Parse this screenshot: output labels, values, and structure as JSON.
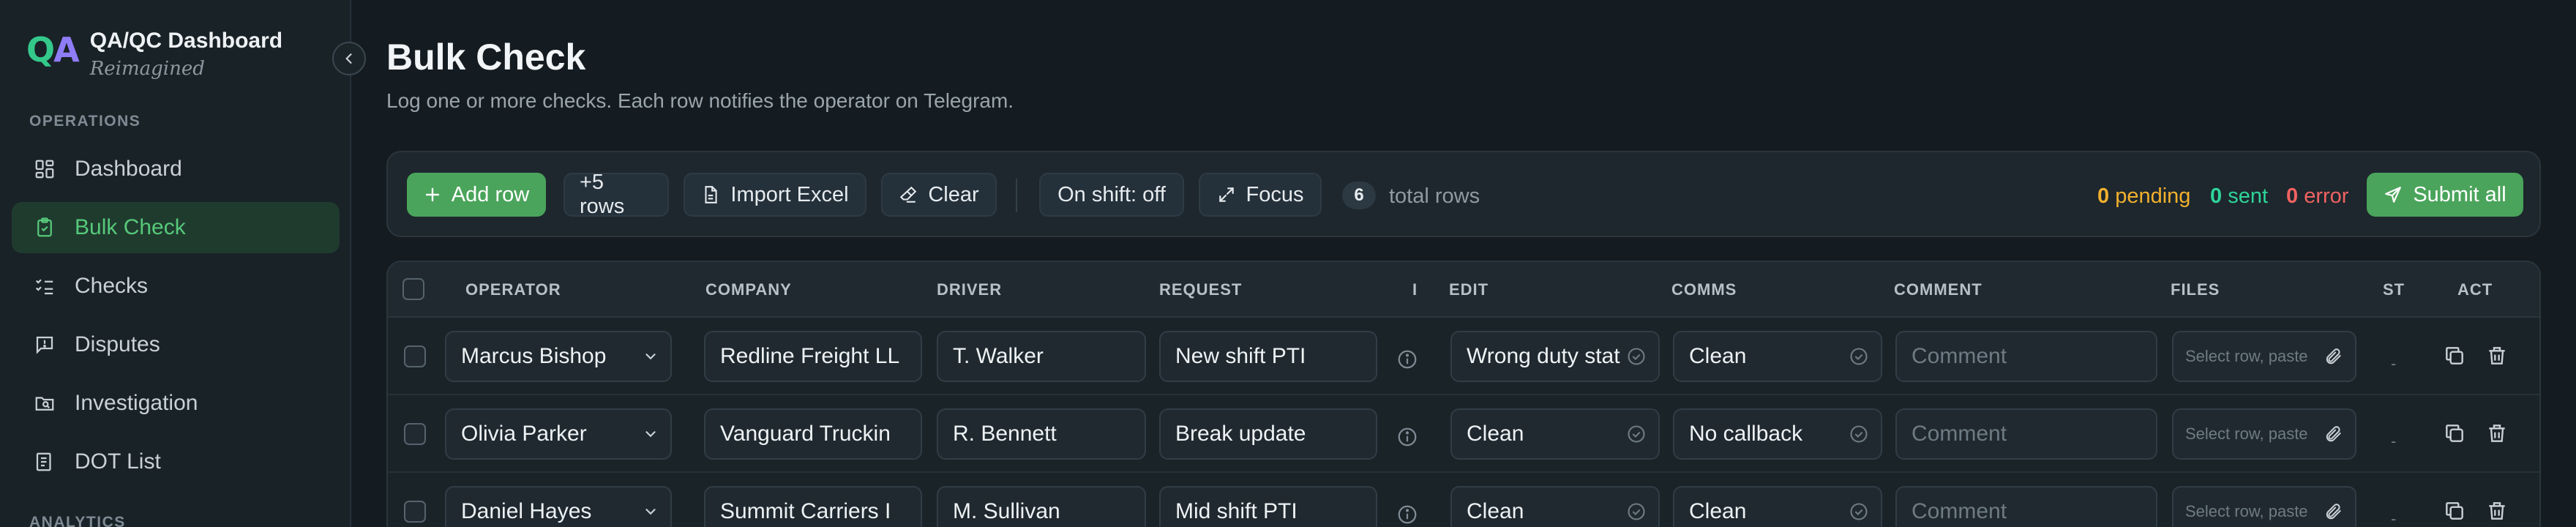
{
  "brand": {
    "logo_q": "Q",
    "logo_a": "A",
    "title": "QA/QC Dashboard",
    "subtitle": "Reimagined"
  },
  "sidebar": {
    "section_operations": "OPERATIONS",
    "section_analytics": "ANALYTICS",
    "items": [
      {
        "label": "Dashboard",
        "icon": "dashboard-icon",
        "active": false
      },
      {
        "label": "Bulk Check",
        "icon": "clipboard-check-icon",
        "active": true
      },
      {
        "label": "Checks",
        "icon": "checklist-icon",
        "active": false
      },
      {
        "label": "Disputes",
        "icon": "message-alert-icon",
        "active": false
      },
      {
        "label": "Investigation",
        "icon": "folder-search-icon",
        "active": false
      },
      {
        "label": "DOT List",
        "icon": "list-icon",
        "active": false
      }
    ]
  },
  "page": {
    "title": "Bulk Check",
    "subtitle": "Log one or more checks. Each row notifies the operator on Telegram."
  },
  "toolbar": {
    "add_row": "Add row",
    "plus_rows": "+5 rows",
    "import_excel": "Import Excel",
    "clear": "Clear",
    "on_shift": "On shift: off",
    "focus": "Focus",
    "total_count": "6",
    "total_label": "total rows",
    "pending_count": "0",
    "pending_label": "pending",
    "sent_count": "0",
    "sent_label": "sent",
    "error_count": "0",
    "error_label": "error",
    "submit_all": "Submit all"
  },
  "table": {
    "headers": [
      "OPERATOR",
      "COMPANY",
      "DRIVER",
      "REQUEST",
      "I",
      "EDIT",
      "COMMS",
      "COMMENT",
      "FILES",
      "ST",
      "ACT"
    ],
    "comment_placeholder": "Comment",
    "files_placeholder": "Select row, paste",
    "status_placeholder": "-",
    "rows": [
      {
        "operator": "Marcus Bishop",
        "company": "Redline Freight LL",
        "driver": "T. Walker",
        "request": "New shift PTI",
        "edit": "Wrong duty stat",
        "comms": "Clean"
      },
      {
        "operator": "Olivia Parker",
        "company": "Vanguard Truckin",
        "driver": "R. Bennett",
        "request": "Break update",
        "edit": "Clean",
        "comms": "No callback"
      },
      {
        "operator": "Daniel Hayes",
        "company": "Summit Carriers I",
        "driver": "M. Sullivan",
        "request": "Mid shift PTI",
        "edit": "Clean",
        "comms": "Clean"
      }
    ]
  },
  "colors": {
    "accent_green": "#4aa45b",
    "active_nav_text": "#56c97a",
    "pending": "#f2b02e",
    "sent": "#2fd49a",
    "error": "#f06262"
  }
}
